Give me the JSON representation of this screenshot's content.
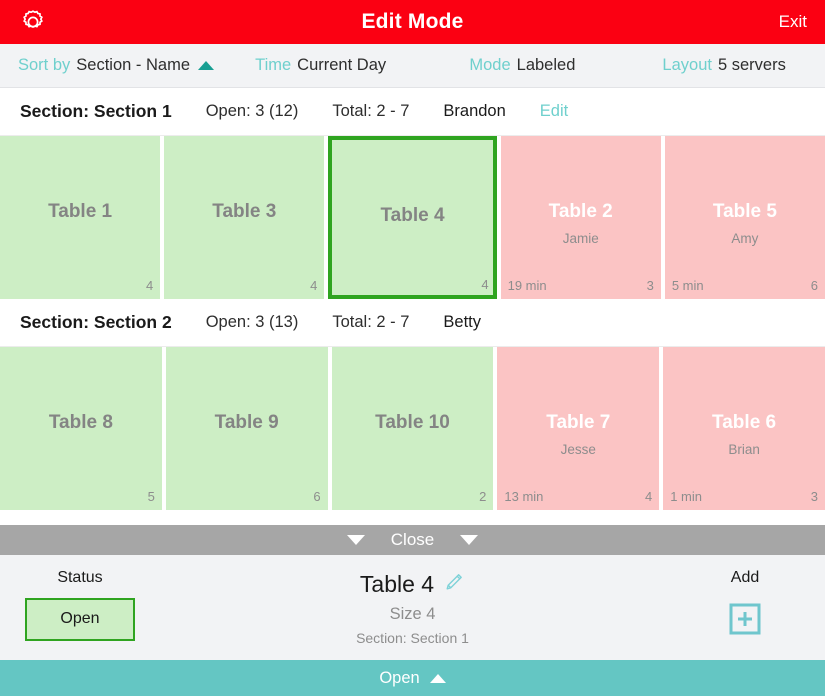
{
  "titlebar": {
    "gear_icon": "gear-icon",
    "title": "Edit Mode",
    "exit_label": "Exit",
    "background_color": "#fb0012"
  },
  "filterbar": {
    "accent_color": "#6fd0cd",
    "items": [
      {
        "label": "Sort by",
        "value": "Section - Name",
        "caret": "sort-ascending-caret"
      },
      {
        "label": "Time",
        "value": "Current Day"
      },
      {
        "label": "Mode",
        "value": "Labeled"
      },
      {
        "label": "Layout",
        "value": "5 servers"
      }
    ]
  },
  "sections": [
    {
      "title": "Section: Section 1",
      "open": "Open: 3 (12)",
      "total": "Total: 2 - 7",
      "server": "Brandon",
      "edit_label": "Edit",
      "tables": [
        {
          "name": "Table 1",
          "status": "green",
          "guest": "",
          "timer": "",
          "size": "4",
          "selected": false
        },
        {
          "name": "Table 3",
          "status": "green",
          "guest": "",
          "timer": "",
          "size": "4",
          "selected": false
        },
        {
          "name": "Table 4",
          "status": "green",
          "guest": "",
          "timer": "",
          "size": "4",
          "selected": true
        },
        {
          "name": "Table 2",
          "status": "red",
          "guest": "Jamie",
          "timer": "19 min",
          "size": "3",
          "selected": false
        },
        {
          "name": "Table 5",
          "status": "red",
          "guest": "Amy",
          "timer": "5 min",
          "size": "6",
          "selected": false
        }
      ]
    },
    {
      "title": "Section: Section 2",
      "open": "Open: 3 (13)",
      "total": "Total: 2 - 7",
      "server": "Betty",
      "edit_label": "",
      "tables": [
        {
          "name": "Table 8",
          "status": "green",
          "guest": "",
          "timer": "",
          "size": "5",
          "selected": false
        },
        {
          "name": "Table 9",
          "status": "green",
          "guest": "",
          "timer": "",
          "size": "6",
          "selected": false
        },
        {
          "name": "Table 10",
          "status": "green",
          "guest": "",
          "timer": "",
          "size": "2",
          "selected": false
        },
        {
          "name": "Table 7",
          "status": "red",
          "guest": "Jesse",
          "timer": "13 min",
          "size": "4",
          "selected": false
        },
        {
          "name": "Table 6",
          "status": "red",
          "guest": "Brian",
          "timer": "1 min",
          "size": "3",
          "selected": false
        }
      ]
    }
  ],
  "closebar": {
    "label": "Close",
    "left_caret": "chevron-down-icon",
    "right_caret": "chevron-down-icon"
  },
  "detail": {
    "status_heading": "Status",
    "status_value": "Open",
    "table_name": "Table 4",
    "edit_icon": "pencil-icon",
    "size_text": "Size 4",
    "section_text": "Section: Section 1",
    "add_heading": "Add",
    "add_icon": "plus-square-icon"
  },
  "bottombar": {
    "label": "Open",
    "caret": "chevron-up-icon",
    "background_color": "#64c6c3"
  },
  "colors": {
    "open_green_bg": "#cdeec5",
    "seated_red_bg": "#fbc4c4",
    "selected_border": "#2fa420",
    "accent_teal": "#6fd0cd"
  }
}
